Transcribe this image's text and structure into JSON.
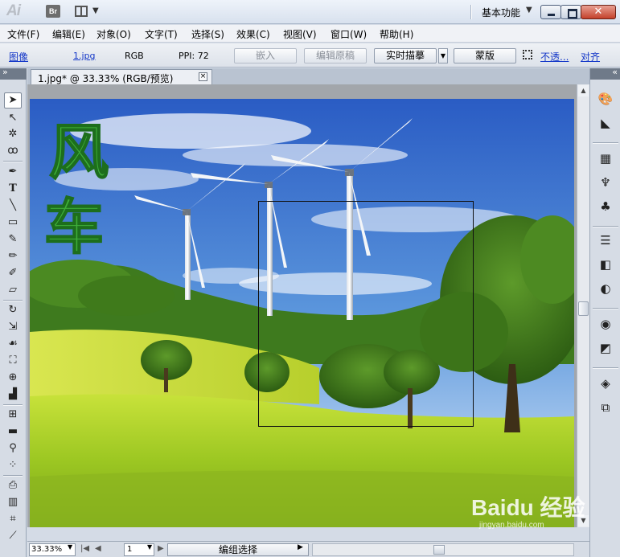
{
  "app": {
    "logo": "Ai",
    "bridge_label": "Br",
    "workspace": "基本功能"
  },
  "menu": [
    "文件(F)",
    "编辑(E)",
    "对象(O)",
    "文字(T)",
    "选择(S)",
    "效果(C)",
    "视图(V)",
    "窗口(W)",
    "帮助(H)"
  ],
  "control_bar": {
    "object_type": "图像",
    "file_link": "1.jpg",
    "color_mode": "RGB",
    "ppi": "PPI: 72",
    "embed": "嵌入",
    "edit_original": "编辑原稿",
    "live_trace": "实时描摹",
    "mask": "蒙版",
    "opacity": "不透...",
    "align": "对齐"
  },
  "document": {
    "tab_title": "1.jpg* @ 33.33% (RGB/预览)",
    "close": "×"
  },
  "artwork": {
    "title_chars": [
      "风",
      "车"
    ]
  },
  "statusbar": {
    "zoom": "33.33%",
    "page": "1",
    "status_text": "编组选择"
  },
  "watermark": {
    "text": "Baidu 经验",
    "sub": "jingyan.baidu.com"
  },
  "colors": {
    "sky_top": "#2f63c6",
    "grass": "#b8d928",
    "title_green": "#3fae3a"
  }
}
